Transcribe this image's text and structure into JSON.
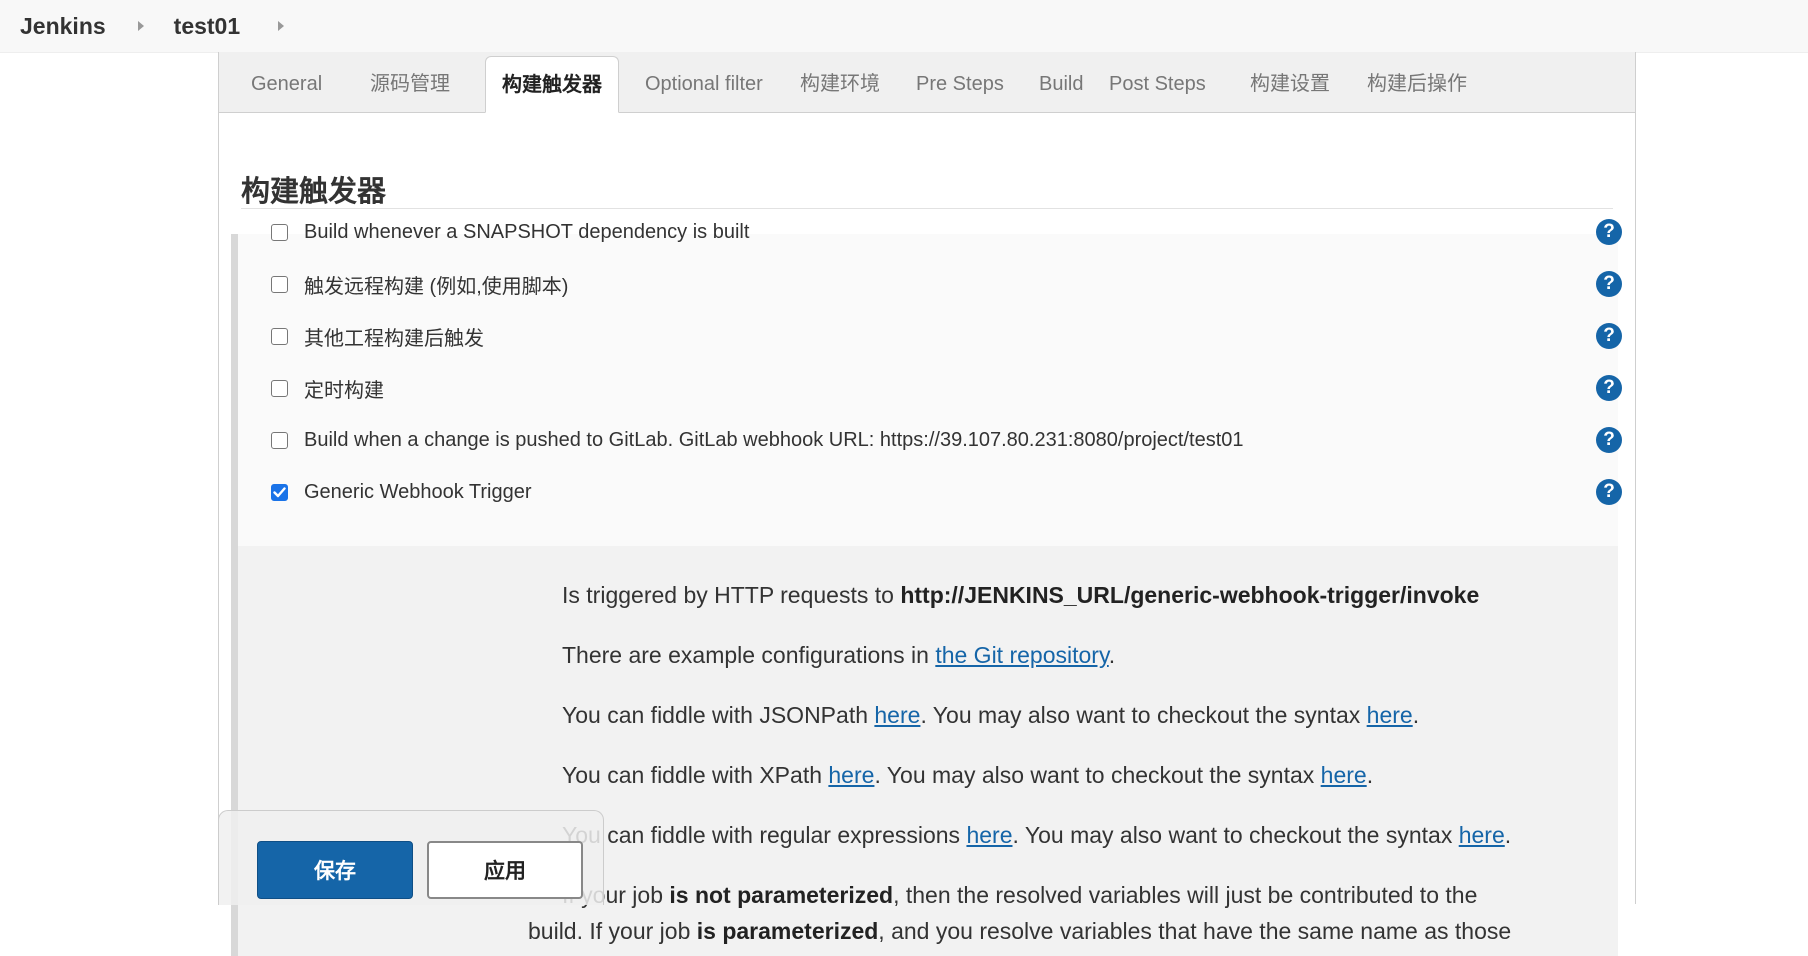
{
  "breadcrumb": {
    "root": "Jenkins",
    "job": "test01"
  },
  "tabs": [
    {
      "label": "General"
    },
    {
      "label": "源码管理"
    },
    {
      "label": "构建触发器"
    },
    {
      "label": "Optional filter"
    },
    {
      "label": "构建环境"
    },
    {
      "label": "Pre Steps"
    },
    {
      "label": "Build"
    },
    {
      "label": "Post Steps"
    },
    {
      "label": "构建设置"
    },
    {
      "label": "构建后操作"
    }
  ],
  "active_tab": "构建触发器",
  "section": {
    "title": "构建触发器"
  },
  "triggers": [
    {
      "label": "Build whenever a SNAPSHOT dependency is built",
      "checked": false
    },
    {
      "label": "触发远程构建 (例如,使用脚本)",
      "checked": false
    },
    {
      "label": "其他工程构建后触发",
      "checked": false
    },
    {
      "label": "定时构建",
      "checked": false
    },
    {
      "label": "Build when a change is pushed to GitLab. GitLab webhook URL: https://39.107.80.231:8080/project/test01",
      "checked": false
    },
    {
      "label": "Generic Webhook Trigger",
      "checked": true
    }
  ],
  "help_icon": "question-mark-icon",
  "details": {
    "line1_prefix": "Is triggered by HTTP requests to ",
    "line1_url": "http://JENKINS_URL/generic-webhook-trigger/invoke",
    "line2_prefix": "There are example configurations in ",
    "line2_link": "the Git repository",
    "line2_suffix": ".",
    "line3_prefix": "You can fiddle with JSONPath ",
    "line3_link1": "here",
    "line3_mid": ". You may also want to checkout the syntax ",
    "line3_link2": "here",
    "line3_suffix": ".",
    "line4_prefix": "You can fiddle with XPath ",
    "line4_link1": "here",
    "line4_mid": ". You may also want to checkout the syntax ",
    "line4_link2": "here",
    "line4_suffix": ".",
    "line5_prefix": "You can fiddle with regular expressions ",
    "line5_link1": "here",
    "line5_mid": ". You may also want to checkout the syntax ",
    "line5_link2": "here",
    "line5_suffix": ".",
    "line6_prefix": "If your job ",
    "line6_bold": "is not parameterized",
    "line6_suffix": ", then the resolved variables will just be contributed to the",
    "line7_prefix": "build. If your job ",
    "line7_bold": "is parameterized",
    "line7_suffix": ", and you resolve variables that have the same name as those"
  },
  "buttons": {
    "save": "保存",
    "apply": "应用"
  },
  "colors": {
    "accent": "#1565a8",
    "checkbox_checked": "#1a73e8"
  }
}
